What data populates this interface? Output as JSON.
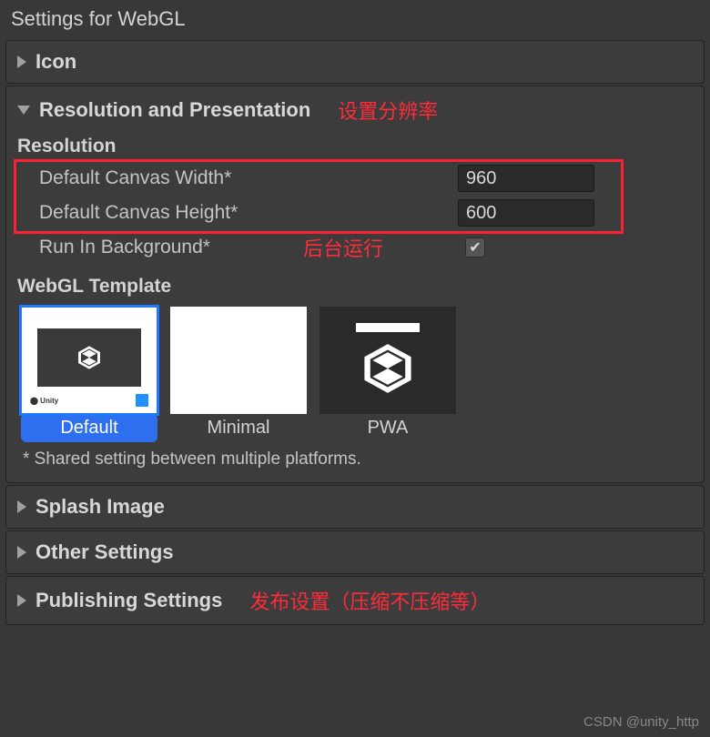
{
  "title": "Settings for WebGL",
  "sections": {
    "icon": {
      "label": "Icon"
    },
    "resolution": {
      "label": "Resolution and Presentation",
      "annotation": "设置分辨率",
      "subheading": "Resolution",
      "fields": {
        "width": {
          "label": "Default Canvas Width*",
          "value": "960"
        },
        "height": {
          "label": "Default Canvas Height*",
          "value": "600"
        },
        "runInBg": {
          "label": "Run In Background*",
          "annotation": "后台运行",
          "checked": true
        }
      },
      "template": {
        "heading": "WebGL Template",
        "options": {
          "default": "Default",
          "minimal": "Minimal",
          "pwa": "PWA"
        }
      },
      "footnote": "* Shared setting between multiple platforms."
    },
    "splash": {
      "label": "Splash Image"
    },
    "other": {
      "label": "Other Settings"
    },
    "publishing": {
      "label": "Publishing Settings",
      "annotation": "发布设置（压缩不压缩等）"
    }
  },
  "watermark": "CSDN @unity_http"
}
